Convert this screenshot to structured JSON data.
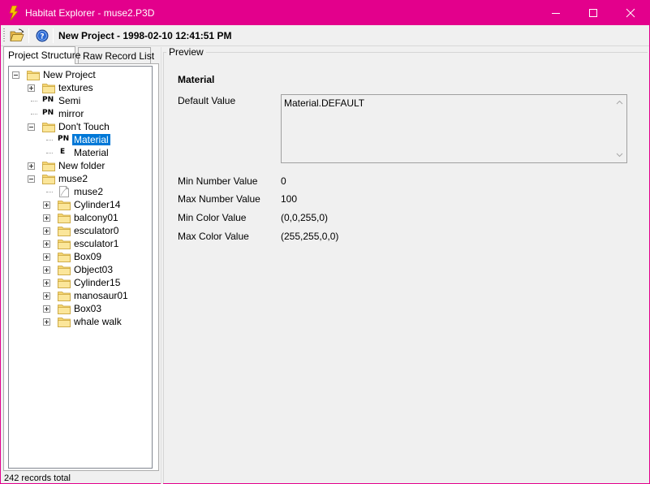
{
  "window": {
    "title": "Habitat Explorer - muse2.P3D",
    "accent_color": "#e3008c"
  },
  "toolbar": {
    "open_icon": "folder-open-icon",
    "help_icon": "help-icon",
    "project_title": "New Project - 1998-02-10 12:41:51 PM"
  },
  "tabs": [
    {
      "label": "Project Structure",
      "active": true
    },
    {
      "label": "Raw Record List",
      "active": false
    }
  ],
  "tree": [
    {
      "label": "New Project",
      "icon": "folder",
      "depth": 0,
      "expander": "minus"
    },
    {
      "label": "textures",
      "icon": "folder",
      "depth": 1,
      "expander": "plus"
    },
    {
      "label": "Semi",
      "icon": "PN",
      "depth": 1,
      "expander": "none"
    },
    {
      "label": "mirror",
      "icon": "PN",
      "depth": 1,
      "expander": "none"
    },
    {
      "label": "Don't Touch",
      "icon": "folder",
      "depth": 1,
      "expander": "minus"
    },
    {
      "label": "Material",
      "icon": "PN",
      "depth": 2,
      "expander": "none",
      "selected": true
    },
    {
      "label": "Material",
      "icon": "E",
      "depth": 2,
      "expander": "none"
    },
    {
      "label": "New folder",
      "icon": "folder",
      "depth": 1,
      "expander": "plus"
    },
    {
      "label": "muse2",
      "icon": "folder",
      "depth": 1,
      "expander": "minus"
    },
    {
      "label": "muse2",
      "icon": "file",
      "depth": 2,
      "expander": "none"
    },
    {
      "label": "Cylinder14",
      "icon": "folder",
      "depth": 2,
      "expander": "plus"
    },
    {
      "label": "balcony01",
      "icon": "folder",
      "depth": 2,
      "expander": "plus"
    },
    {
      "label": "esculator0",
      "icon": "folder",
      "depth": 2,
      "expander": "plus"
    },
    {
      "label": "esculator1",
      "icon": "folder",
      "depth": 2,
      "expander": "plus"
    },
    {
      "label": "Box09",
      "icon": "folder",
      "depth": 2,
      "expander": "plus"
    },
    {
      "label": "Object03",
      "icon": "folder",
      "depth": 2,
      "expander": "plus"
    },
    {
      "label": "Cylinder15",
      "icon": "folder",
      "depth": 2,
      "expander": "plus"
    },
    {
      "label": "manosaur01",
      "icon": "folder",
      "depth": 2,
      "expander": "plus"
    },
    {
      "label": "Box03",
      "icon": "folder",
      "depth": 2,
      "expander": "plus"
    },
    {
      "label": "whale walk",
      "icon": "folder",
      "depth": 2,
      "expander": "plus"
    }
  ],
  "status": "242 records total",
  "preview": {
    "group_title": "Preview",
    "section_title": "Material",
    "default_value_label": "Default Value",
    "default_value": "Material.DEFAULT",
    "fields": [
      {
        "label": "Min Number Value",
        "value": "0"
      },
      {
        "label": "Max Number Value",
        "value": "100"
      },
      {
        "label": "Min Color Value",
        "value": "(0,0,255,0)"
      },
      {
        "label": "Max Color Value",
        "value": "(255,255,0,0)"
      }
    ]
  }
}
